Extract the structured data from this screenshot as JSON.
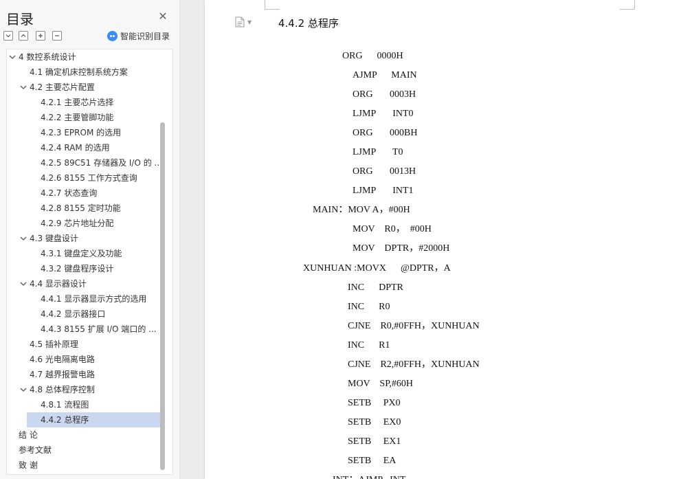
{
  "sidebar": {
    "title": "目录",
    "close_icon": "close-icon",
    "tools": [
      "collapse-all-icon",
      "expand-all-icon",
      "add-level-icon",
      "remove-level-icon"
    ],
    "smart_toc_label": "智能识别目录",
    "toc": [
      {
        "label": "4 数控系统设计",
        "expanded": true
      },
      {
        "label": "4.1  确定机床控制系统方案"
      },
      {
        "label": "4.2  主要芯片配置",
        "expanded": true
      },
      {
        "label": "4.2.1 主要芯片选择"
      },
      {
        "label": "4.2.2  主要管脚功能"
      },
      {
        "label": "4.2.3 EPROM 的选用"
      },
      {
        "label": "4.2.4 RAM 的选用"
      },
      {
        "label": "4.2.5 89C51 存储器及 I/O 的 ..."
      },
      {
        "label": "4.2.6 8155  工作方式查询"
      },
      {
        "label": "4.2.7 状态查询"
      },
      {
        "label": "4.2.8 8155  定时功能"
      },
      {
        "label": "4.2.9  芯片地址分配"
      },
      {
        "label": "4.3  键盘设计",
        "expanded": true
      },
      {
        "label": "4.3.1 键盘定义及功能"
      },
      {
        "label": "4.3.2  键盘程序设计"
      },
      {
        "label": "4.4 显示器设计",
        "expanded": true
      },
      {
        "label": "4.4.1 显示器显示方式的选用"
      },
      {
        "label": "4.4.2 显示器接口"
      },
      {
        "label": "4.4.3 8155 扩展 I/O 端口的 ..."
      },
      {
        "label": "4.5  插补原理"
      },
      {
        "label": "4.6 光电隔离电路"
      },
      {
        "label": "4.7 越界报警电路"
      },
      {
        "label": "4.8  总体程序控制",
        "expanded": true
      },
      {
        "label": "4.8.1 流程图"
      },
      {
        "label": "4.4.2 总程序",
        "selected": true
      },
      {
        "label": "结  论"
      },
      {
        "label": "参考文献"
      },
      {
        "label": "致   谢"
      }
    ]
  },
  "document": {
    "page_icon": "document-icon",
    "heading": "4.4.2 总程序",
    "code_lines": [
      "ORG      0000H",
      "AJMP      MAIN",
      "ORG       0003H",
      "LJMP       INT0",
      "ORG       000BH",
      "LJMP       T0",
      "ORG       0013H",
      "LJMP       INT1",
      "MAIN：MOV A，#00H",
      "MOV    R0，  #00H",
      "MOV    DPTR，#2000H",
      "XUNHUAN :MOVX      @DPTR，A",
      "INC      DPTR",
      "INC      R0",
      "CJNE    R0,#0FFH，XUNHUAN",
      "INC      R1",
      "CJNE    R2,#0FFH，XUNHUAN",
      "MOV    SP,#60H",
      "SETB     PX0",
      "SETB     EX0",
      "SETB     EX1",
      "SETB     EA",
      "INT：AJMP   INT"
    ]
  },
  "colors": {
    "selected_bg": "#c9d7ef",
    "accent": "#3b8cf5"
  }
}
